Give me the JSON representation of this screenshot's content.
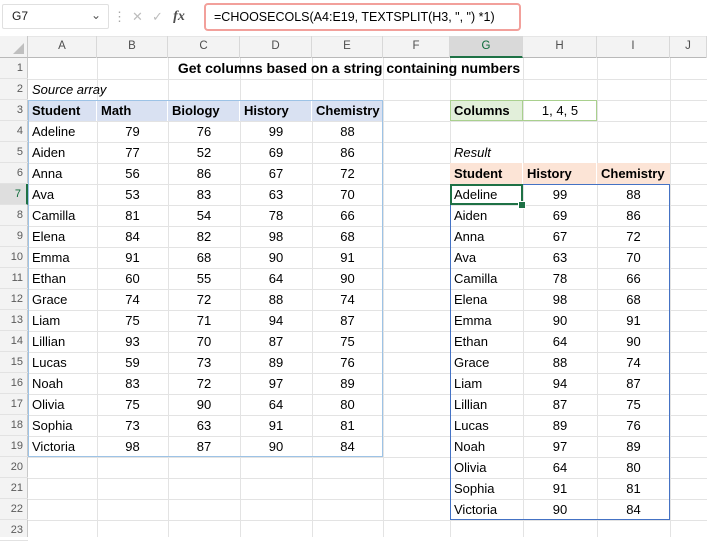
{
  "formula_bar": {
    "name_box": "G7",
    "chevron_icon": "⌄",
    "dots_icon": "⋮",
    "cancel_icon": "✕",
    "enter_icon": "✓",
    "fx_icon": "fx",
    "formula": "=CHOOSECOLS(A4:E19, TEXTSPLIT(H3, \", \") *1)"
  },
  "selection": {
    "cell": "G7",
    "column": "G",
    "row": "7"
  },
  "column_headers": [
    "A",
    "B",
    "C",
    "D",
    "E",
    "F",
    "G",
    "H",
    "I",
    "J"
  ],
  "row_headers": [
    "1",
    "2",
    "3",
    "4",
    "5",
    "6",
    "7",
    "8",
    "9",
    "10",
    "11",
    "12",
    "13",
    "14",
    "15",
    "16",
    "17",
    "18",
    "19",
    "20",
    "21",
    "22",
    "23"
  ],
  "title": "Get columns based on a string containing numbers",
  "source_table": {
    "label": "Source array",
    "headers": [
      "Student",
      "Math",
      "Biology",
      "History",
      "Chemistry"
    ],
    "rows": [
      [
        "Adeline",
        "79",
        "76",
        "99",
        "88"
      ],
      [
        "Aiden",
        "77",
        "52",
        "69",
        "86"
      ],
      [
        "Anna",
        "56",
        "86",
        "67",
        "72"
      ],
      [
        "Ava",
        "53",
        "83",
        "63",
        "70"
      ],
      [
        "Camilla",
        "81",
        "54",
        "78",
        "66"
      ],
      [
        "Elena",
        "84",
        "82",
        "98",
        "68"
      ],
      [
        "Emma",
        "91",
        "68",
        "90",
        "91"
      ],
      [
        "Ethan",
        "60",
        "55",
        "64",
        "90"
      ],
      [
        "Grace",
        "74",
        "72",
        "88",
        "74"
      ],
      [
        "Liam",
        "75",
        "71",
        "94",
        "87"
      ],
      [
        "Lillian",
        "93",
        "70",
        "87",
        "75"
      ],
      [
        "Lucas",
        "59",
        "73",
        "89",
        "76"
      ],
      [
        "Noah",
        "83",
        "72",
        "97",
        "89"
      ],
      [
        "Olivia",
        "75",
        "90",
        "64",
        "80"
      ],
      [
        "Sophia",
        "73",
        "63",
        "91",
        "81"
      ],
      [
        "Victoria",
        "98",
        "87",
        "90",
        "84"
      ]
    ]
  },
  "columns_spec": {
    "label": "Columns",
    "value": "1, 4, 5"
  },
  "result_table": {
    "label": "Result",
    "headers": [
      "Student",
      "History",
      "Chemistry"
    ],
    "rows": [
      [
        "Adeline",
        "99",
        "88"
      ],
      [
        "Aiden",
        "69",
        "86"
      ],
      [
        "Anna",
        "67",
        "72"
      ],
      [
        "Ava",
        "63",
        "70"
      ],
      [
        "Camilla",
        "78",
        "66"
      ],
      [
        "Elena",
        "98",
        "68"
      ],
      [
        "Emma",
        "90",
        "91"
      ],
      [
        "Ethan",
        "64",
        "90"
      ],
      [
        "Grace",
        "88",
        "74"
      ],
      [
        "Liam",
        "94",
        "87"
      ],
      [
        "Lillian",
        "87",
        "75"
      ],
      [
        "Lucas",
        "89",
        "76"
      ],
      [
        "Noah",
        "97",
        "89"
      ],
      [
        "Olivia",
        "64",
        "80"
      ],
      [
        "Sophia",
        "91",
        "81"
      ],
      [
        "Victoria",
        "90",
        "84"
      ]
    ]
  },
  "colors": {
    "selection_green": "#1e7145",
    "spill_border_blue": "#4472c4",
    "formula_highlight_pink": "#f2a09b",
    "source_header_fill": "#d9e1f2",
    "result_header_fill": "#fce4d6",
    "columns_label_fill": "#e2efda",
    "source_table_border": "#9dc3e6",
    "columns_spec_border": "#a9d08e"
  }
}
